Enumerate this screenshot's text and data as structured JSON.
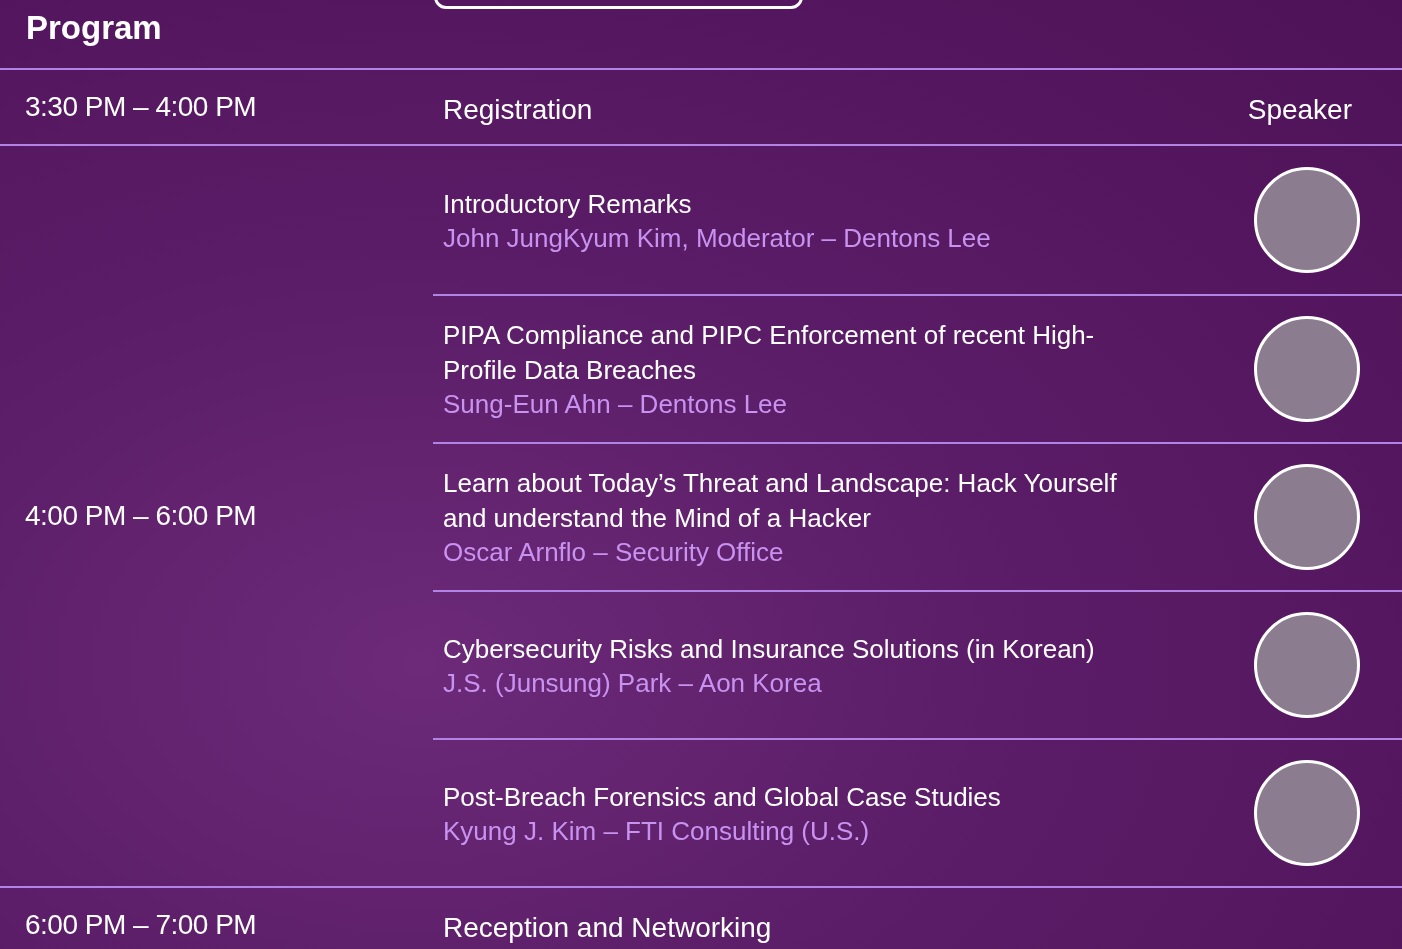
{
  "heading": "Program",
  "rows": [
    {
      "kind": "header",
      "time": "3:30 PM – 4:00 PM",
      "title": "Registration",
      "column_label": "Speaker"
    },
    {
      "kind": "sessions",
      "time": "4:00 PM – 6:00 PM",
      "sessions": [
        {
          "title": "Introductory Remarks",
          "speaker": "John JungKyum Kim, Moderator – Dentons Lee"
        },
        {
          "title": "PIPA Compliance and PIPC Enforcement of recent High-Profile Data Breaches",
          "speaker": "Sung-Eun Ahn – Dentons Lee"
        },
        {
          "title": "Learn about Today’s Threat and Landscape: Hack Yourself and understand the Mind of a Hacker",
          "speaker": "Oscar Arnflo – Security Office"
        },
        {
          "title": "Cybersecurity Risks and Insurance Solutions (in Korean)",
          "speaker": "J.S. (Junsung) Park – Aon Korea"
        },
        {
          "title": "Post-Breach Forensics and Global Case Studies",
          "speaker": "Kyung J. Kim – FTI Consulting (U.S.)"
        }
      ]
    },
    {
      "kind": "header",
      "time": "6:00 PM – 7:00 PM",
      "title": "Reception and Networking"
    }
  ]
}
